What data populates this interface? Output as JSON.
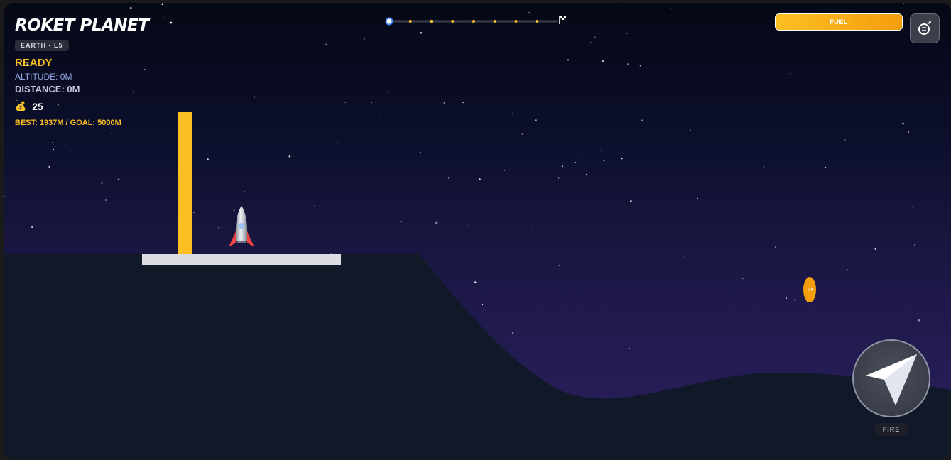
{
  "game": {
    "title": "ROKET PLANET",
    "level": "EARTH - L5",
    "status": "READY",
    "altitude": "ALTITUDE: 0M",
    "distance": "DISTANCE: 0M",
    "coins": "25",
    "best_goal": "BEST: 1937M / GOAL: 5000M"
  },
  "progress": {
    "checkpoints": 7,
    "current": 0,
    "goal_icon": "checkered-flag-icon"
  },
  "fuel": {
    "label": "FUEL",
    "level": 1.0
  },
  "settings": {
    "icon": "settings-gauge-icon"
  },
  "pickup": {
    "label": "1",
    "icon": "coin-icon"
  },
  "fire": {
    "label": "FIRE",
    "icon": "paper-plane-icon"
  },
  "colors": {
    "accent": "#fbbf24",
    "fuel": "#f59e0b",
    "terrain": "#111827",
    "altitude_text": "#93a8e6"
  },
  "icons": {
    "coins": "money-bag-icon"
  }
}
